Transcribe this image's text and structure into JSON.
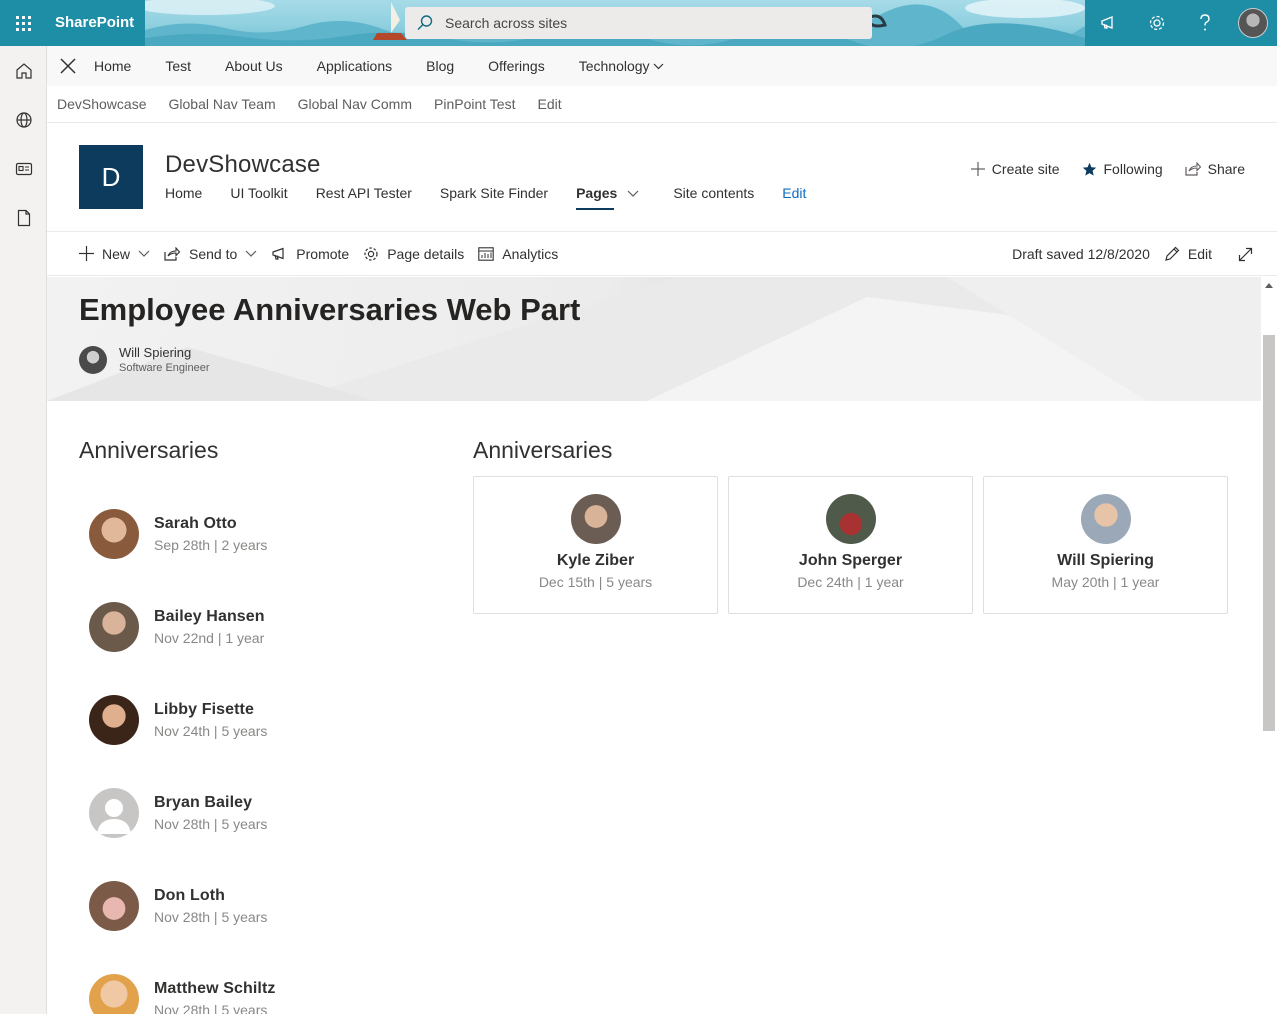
{
  "suite": {
    "brand": "SharePoint",
    "search_placeholder": "Search across sites"
  },
  "hub_nav": {
    "items": [
      "Home",
      "Test",
      "About Us",
      "Applications",
      "Blog",
      "Offerings",
      "Technology"
    ]
  },
  "hub_sub": {
    "items": [
      "DevShowcase",
      "Global Nav Team",
      "Global Nav Comm",
      "PinPoint Test",
      "Edit"
    ]
  },
  "site": {
    "logo_letter": "D",
    "title": "DevShowcase",
    "nav": [
      "Home",
      "UI Toolkit",
      "Rest API Tester",
      "Spark Site Finder",
      "Pages",
      "Site contents",
      "Edit"
    ],
    "actions": {
      "create_site": "Create site",
      "following": "Following",
      "share": "Share"
    }
  },
  "commands": {
    "new": "New",
    "send_to": "Send to",
    "promote": "Promote",
    "page_details": "Page details",
    "analytics": "Analytics",
    "draft_saved": "Draft saved 12/8/2020",
    "edit": "Edit"
  },
  "page": {
    "title": "Employee Anniversaries Web Part",
    "author_name": "Will Spiering",
    "author_role": "Software Engineer"
  },
  "list_webpart": {
    "title": "Anniversaries",
    "people": [
      {
        "name": "Sarah Otto",
        "sub": "Sep 28th | 2 years",
        "color": "#8a5a3c"
      },
      {
        "name": "Bailey Hansen",
        "sub": "Nov 22nd | 1 year",
        "color": "#6b5a4a"
      },
      {
        "name": "Libby Fisette",
        "sub": "Nov 24th | 5 years",
        "color": "#5b3b2a"
      },
      {
        "name": "Bryan Bailey",
        "sub": "Nov 28th | 5 years",
        "color": "#c8c6c4"
      },
      {
        "name": "Don Loth",
        "sub": "Nov 28th | 5 years",
        "color": "#9b6b58"
      },
      {
        "name": "Matthew Schiltz",
        "sub": "Nov 28th | 5 years",
        "color": "#d9a05b"
      }
    ]
  },
  "card_webpart": {
    "title": "Anniversaries",
    "people": [
      {
        "name": "Kyle Ziber",
        "sub": "Dec 15th | 5 years",
        "color": "#7a6a5e"
      },
      {
        "name": "John Sperger",
        "sub": "Dec 24th | 1 year",
        "color": "#7a3030"
      },
      {
        "name": "Will Spiering",
        "sub": "May 20th | 1 year",
        "color": "#9aa8b8"
      }
    ]
  }
}
